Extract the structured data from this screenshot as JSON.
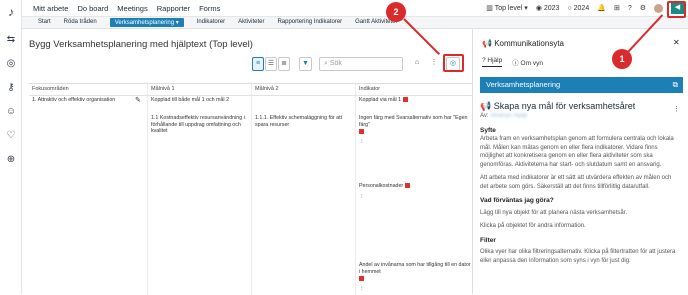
{
  "topnav": {
    "items": [
      "Mitt arbete",
      "Do board",
      "Meetings",
      "Rapporter",
      "Forms"
    ],
    "level": "Top level",
    "year1": "2023",
    "year2": "2024"
  },
  "subtabs": [
    "Start",
    "Röda tråden",
    "Verksamhetsplanering ▾",
    "Indikatorer",
    "Aktiviteter",
    "Rapportering Indikatorer",
    "Gantt Aktiviteter"
  ],
  "page": {
    "title": "Bygg Verksamhetsplanering med hjälptext (Top level)",
    "search_placeholder": "Sök"
  },
  "columns": [
    "Fokusområden",
    "Målnivå 1",
    "Målnivå 2",
    "Indikator"
  ],
  "rows": {
    "focus": "1. Attraktiv och effektiv organisation",
    "m1a": "Kopplad till både mål 1 och mål 2",
    "m1b": "1.1 Kostnadseffektiv resursanvändning i förhållande till uppdrag omfattning och kvalitet",
    "m2a": "1.1.1. Effektiv schemaläggning för att spara resurser",
    "ind1": "Kopplad via mål 1",
    "ind2": "Ingen färg med Svarsalternativ som har \"Egen färg\"",
    "ind3": "Personalkostnader",
    "ind4": "Andel av invånarna som har tillgång till en dator i hemmet"
  },
  "panel": {
    "title": "Kommunikationsyta",
    "tab_help": "Hjälp",
    "tab_about": "Om vyn",
    "header": "Verksamhetsplanering",
    "post_title": "Skapa nya mål för verksamhetsåret",
    "author_prefix": "Av:",
    "author": "Stratsys Hjälp",
    "s1": "Syfte",
    "p1": "Arbeta fram en verksamhetsplan genom att formulera centrala och lokala mål. Målen kan mätas genom en eller flera indikatorer. Vidare finns möjlighet att konkretisera genom en eller flera aktiviteter som ska genomföras. Aktiviteterna har start- och slutdatum samt en ansvarig.",
    "p2": "Att arbeta med indikatorer är ett sätt att utvärdera effekten av målen och det arbete som görs. Säkerställ att det finns tillförlitlig data/utfall.",
    "s2": "Vad förväntas jag göra?",
    "p3": "Lägg till nya objekt för att planera nästa verksamhetsår.",
    "p4": "Klicka på objektet för andra information.",
    "s3": "Filter",
    "p5": "Olika vyer har olika filtreringsalternativ. Klicka på filtertratten för att justera eller anpassa den information som syns i vyn för just dig."
  },
  "markers": {
    "one": "1",
    "two": "2"
  },
  "colors": {
    "accent": "#1c7fb6",
    "marker": "#d92b2b"
  }
}
